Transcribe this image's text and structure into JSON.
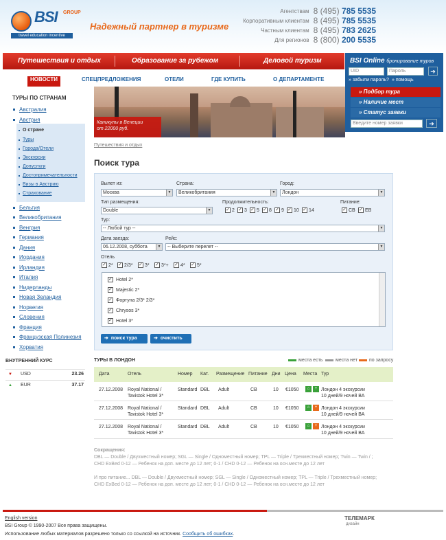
{
  "header": {
    "logo": {
      "brand": "BSI",
      "group": "GROUP",
      "strip": "travel education incentive"
    },
    "slogan": "Надежный партнер в туризме",
    "phones": [
      {
        "label": "Агентствам",
        "prefix": "8 (495)",
        "number": "785 5535"
      },
      {
        "label": "Корпоративным клиентам",
        "prefix": "8 (495)",
        "number": "785 5535"
      },
      {
        "label": "Частным клиентам",
        "prefix": "8 (495)",
        "number": "783 2625"
      },
      {
        "label": "Для регионов",
        "prefix": "8 (800)",
        "number": "200 5535"
      }
    ]
  },
  "mainnav": [
    "Путешествия и отдых",
    "Образование за рубежом",
    "Деловой туризм"
  ],
  "subnav": [
    "НОВОСТИ",
    "СПЕЦПРЕДЛОЖЕНИЯ",
    "ОТЕЛИ",
    "ГДЕ КУПИТЬ",
    "О ДЕПАРТАМЕНТЕ"
  ],
  "login": {
    "title": "BSI Online",
    "subtitle": "бронирование туров",
    "uid_placeholder": "UID",
    "password_placeholder": "Пароль",
    "forgot": "» забыли пароль?",
    "help": "» помощь",
    "menu": [
      "Подбор тура",
      "Наличие мест",
      "Статус заявки"
    ],
    "request_placeholder": "Введите номер заявки"
  },
  "sidebar": {
    "title": "ТУРЫ ПО СТРАНАМ",
    "countries_top": [
      "Австралия",
      "Австрия"
    ],
    "austria_sub": [
      "О стране",
      "Туры",
      "Города/Отели",
      "Экскурсии",
      "Допуслуги",
      "Достопримечательности",
      "Визы в Австрию",
      "Страхование"
    ],
    "countries": [
      "Бельгия",
      "Великобритания",
      "Венгрия",
      "Германия",
      "Дания",
      "Иордания",
      "Ирландия",
      "Италия",
      "Нидерланды",
      "Новая Зеландия",
      "Норвегия",
      "Словения",
      "Франция",
      "Французская Полинезия",
      "Хорватия"
    ]
  },
  "rates": {
    "title": "ВНУТРЕННИЙ КУРС",
    "rows": [
      {
        "currency": "USD",
        "value": "23.26",
        "trend": "down"
      },
      {
        "currency": "EUR",
        "value": "37.17",
        "trend": "up"
      }
    ]
  },
  "banner": {
    "caption_line1": "Каникулы в Венеции",
    "caption_line2": "от 22000 руб."
  },
  "breadcrumb": "Путешествия и отдых",
  "page_title": "Поиск тура",
  "form": {
    "from_label": "Вылет из:",
    "from_value": "Москва",
    "country_label": "Страна:",
    "country_value": "Великобритания",
    "city_label": "Город:",
    "city_value": "Лондон",
    "room_label": "Тип размещения:",
    "room_value": "Double",
    "duration_label": "Продолжительность:",
    "durations": [
      "2",
      "3",
      "5",
      "8",
      "9",
      "10",
      "14"
    ],
    "meal_label": "Питание:",
    "meals": [
      "СВ",
      "ЕВ"
    ],
    "tour_label": "Тур:",
    "tour_value": "-- Любой тур --",
    "date_label": "Дата заезда:",
    "date_value": "06.12.2008, суббота",
    "flight_label": "Рейс:",
    "flight_value": "-- Выберите перелет --",
    "hotel_label": "Отель",
    "stars": [
      "2*",
      "2/3*",
      "3*",
      "3*+",
      "4*",
      "5*"
    ],
    "hotels": [
      "Hotel 2*",
      "Majestic 2*",
      "Фортуна 2/3* 2/3*",
      "Chrysos 3*",
      "Hotel 3*"
    ],
    "search_button": "поиск тура",
    "clear_button": "очистить"
  },
  "results": {
    "title": "ТУРЫ В ЛОНДОН",
    "legend": [
      "места есть",
      "места нет",
      "по запросу"
    ],
    "legend_colors": [
      "#3aa13a",
      "#999999",
      "#e86a1c"
    ],
    "columns": [
      "Дата",
      "Отель",
      "Номер",
      "Кат.",
      "Размещение",
      "Питание",
      "Дни",
      "Цена",
      "Места",
      "Тур"
    ],
    "rows": [
      {
        "date": "27.12.2008",
        "hotel1": "Royal National /",
        "hotel2": "Tavistok Hotel 3*",
        "room": "Standard",
        "cat": "DBL",
        "accom": "Adult",
        "meal": "СВ",
        "days": "10",
        "price": "€1050",
        "tour1": "Лондон 4 экскурсии",
        "tour2": "10 дней/9 ночей ВА"
      },
      {
        "date": "27.12.2008",
        "hotel1": "Royal National /",
        "hotel2": "Tavistok Hotel 3*",
        "room": "Standard",
        "cat": "DBL",
        "accom": "Adult",
        "meal": "СВ",
        "days": "10",
        "price": "€1050",
        "tour1": "Лондон 4 экскурсии",
        "tour2": "10 дней/9 ночей ВА"
      },
      {
        "date": "27.12.2008",
        "hotel1": "Royal National /",
        "hotel2": "Tavistok Hotel 3*",
        "room": "Standard",
        "cat": "DBL",
        "accom": "Adult",
        "meal": "СВ",
        "days": "10",
        "price": "€1050",
        "tour1": "Лондон 4 экскурсии",
        "tour2": "10 дней/9 ночей ВА"
      }
    ]
  },
  "abbreviations": {
    "title": "Сокращения:",
    "line1": "DBL — Double / Двухместный номер; SGL — Single / Одноместный номер; TPL — Triple / Трехместный номер; Twin — Twin / ;",
    "line2": "CHD ExBed 0-12 — Ребенок на доп. месте до 12 лет; 0-1 / CHD 0-12 — Ребенок на осн.месте до 12 лет",
    "line3": "И про питание... DBL — Double / Двухместный номер; SGL — Single / Одноместный номер; TPL — Triple / Трехместный номер;",
    "line4": "CHD ExBed 0-12 — Ребенок на доп. месте до 12 лет; 0-1 / CHD 0-12 — Ребенок на осн.месте до 12 лет"
  },
  "footer": {
    "english": "English version",
    "copyright": "BSI Group © 1990-2007 Все права защищены.",
    "usage": "Использование любых материалов разрешено только со ссылкой на источник.",
    "report": "Сообщить об ошибках",
    "dev_name": "ТЕЛЕМАРК",
    "dev_sub": "дизайн"
  }
}
